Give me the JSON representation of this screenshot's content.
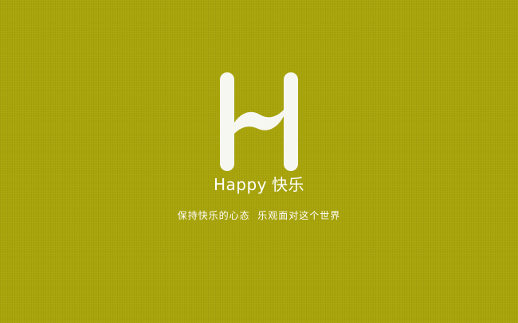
{
  "colors": {
    "background": "#a8a40a",
    "foreground": "#ffffff"
  },
  "logo": {
    "icon": "letter-h-ribbon-icon"
  },
  "brand": {
    "name_en": "Happy",
    "name_cn": "快乐"
  },
  "tagline": "保持快乐的心态  乐观面对这个世界"
}
